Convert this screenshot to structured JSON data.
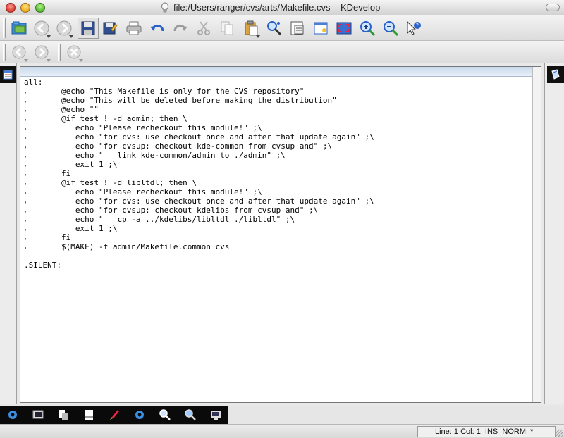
{
  "window": {
    "title": "file:/Users/ranger/cvs/arts/Makefile.cvs – KDevelop"
  },
  "toolbar_main": [
    {
      "icon": "open-project-icon",
      "pressed": false,
      "dropdown": false
    },
    {
      "icon": "back-icon",
      "pressed": false,
      "dropdown": true
    },
    {
      "icon": "forward-icon",
      "pressed": false,
      "dropdown": true
    },
    {
      "icon": "save-icon",
      "pressed": true,
      "dropdown": false
    },
    {
      "icon": "save-all-icon",
      "pressed": false,
      "dropdown": false
    },
    {
      "icon": "print-icon",
      "pressed": false,
      "dropdown": false
    },
    {
      "icon": "undo-icon",
      "pressed": false,
      "dropdown": false
    },
    {
      "icon": "redo-icon",
      "pressed": false,
      "dropdown": false
    },
    {
      "icon": "cut-icon",
      "pressed": false,
      "dropdown": false
    },
    {
      "icon": "copy-icon",
      "pressed": false,
      "dropdown": false
    },
    {
      "icon": "paste-icon",
      "pressed": false,
      "dropdown": true
    },
    {
      "icon": "find-icon",
      "pressed": false,
      "dropdown": false
    },
    {
      "icon": "class-browser-icon",
      "pressed": false,
      "dropdown": false
    },
    {
      "icon": "new-window-icon",
      "pressed": false,
      "dropdown": false
    },
    {
      "icon": "fullscreen-icon",
      "pressed": false,
      "dropdown": false
    },
    {
      "icon": "zoom-in-icon",
      "pressed": false,
      "dropdown": false
    },
    {
      "icon": "zoom-out-icon",
      "pressed": false,
      "dropdown": false
    },
    {
      "icon": "whats-this-icon",
      "pressed": false,
      "dropdown": false
    }
  ],
  "toolbar_nav": [
    {
      "icon": "history-back-icon",
      "dropdown": true
    },
    {
      "icon": "history-forward-icon",
      "dropdown": true
    },
    {
      "icon": "stop-icon",
      "dropdown": true
    }
  ],
  "editor": {
    "lines": [
      {
        "text": "all:",
        "mark": false
      },
      {
        "text": "        @echo \"This Makefile is only for the CVS repository\"",
        "mark": true
      },
      {
        "text": "        @echo \"This will be deleted before making the distribution\"",
        "mark": true
      },
      {
        "text": "        @echo \"\"",
        "mark": true
      },
      {
        "text": "        @if test ! -d admin; then \\",
        "mark": true
      },
      {
        "text": "           echo \"Please recheckout this module!\" ;\\",
        "mark": true
      },
      {
        "text": "           echo \"for cvs: use checkout once and after that update again\" ;\\",
        "mark": true
      },
      {
        "text": "           echo \"for cvsup: checkout kde-common from cvsup and\" ;\\",
        "mark": true
      },
      {
        "text": "           echo \"   link kde-common/admin to ./admin\" ;\\",
        "mark": true
      },
      {
        "text": "           exit 1 ;\\",
        "mark": true
      },
      {
        "text": "        fi",
        "mark": true
      },
      {
        "text": "        @if test ! -d libltdl; then \\",
        "mark": true
      },
      {
        "text": "           echo \"Please recheckout this module!\" ;\\",
        "mark": true
      },
      {
        "text": "           echo \"for cvs: use checkout once and after that update again\" ;\\",
        "mark": true
      },
      {
        "text": "           echo \"for cvsup: checkout kdelibs from cvsup and\" ;\\",
        "mark": true
      },
      {
        "text": "           echo \"   cp -a ../kdelibs/libltdl ./libltdl\" ;\\",
        "mark": true
      },
      {
        "text": "           exit 1 ;\\",
        "mark": true
      },
      {
        "text": "        fi",
        "mark": true
      },
      {
        "text": "        $(MAKE) -f admin/Makefile.common cvs",
        "mark": true
      },
      {
        "text": "",
        "mark": false
      },
      {
        "text": ".SILENT:",
        "mark": false
      }
    ]
  },
  "dock": [
    {
      "icon": "gear-icon"
    },
    {
      "icon": "monitor-icon"
    },
    {
      "icon": "pages-icon"
    },
    {
      "icon": "document-icon"
    },
    {
      "icon": "rocket-icon"
    },
    {
      "icon": "settings-icon"
    },
    {
      "icon": "search-icon"
    },
    {
      "icon": "inspect-icon"
    },
    {
      "icon": "computer-icon"
    }
  ],
  "status": {
    "text": "Line: 1 Col: 1  INS  NORM  *"
  },
  "colors": {
    "accent_blue": "#2a62c8",
    "editor_header": "#c9d9ec"
  }
}
